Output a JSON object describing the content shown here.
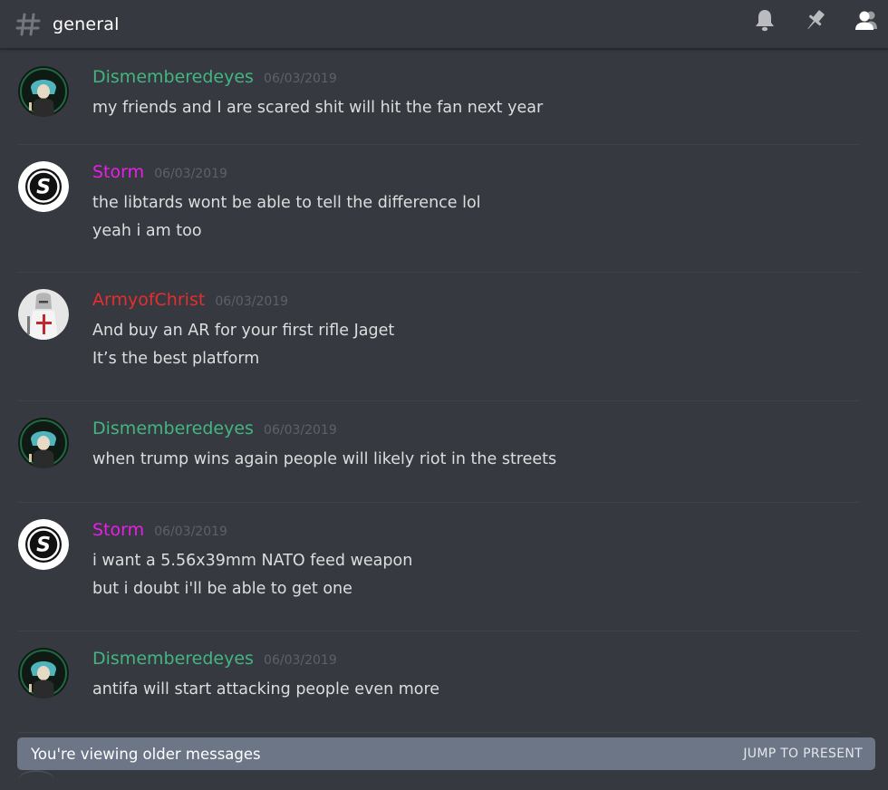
{
  "header": {
    "channel_name": "general",
    "icons": [
      "hash-icon",
      "bell-icon",
      "pin-icon",
      "members-icon"
    ]
  },
  "colors": {
    "background": "#36393f",
    "Dismemberedeyes": "#43b581",
    "Storm": "#e91ee9",
    "ArmyofChrist": "#e62e2e",
    "banner": "#6c7686"
  },
  "messages": [
    {
      "author": "Dismemberedeyes",
      "timestamp": "06/03/2019",
      "lines": [
        "my friends and I are scared shit will hit the fan next year"
      ]
    },
    {
      "author": "Storm",
      "timestamp": "06/03/2019",
      "lines": [
        "the libtards wont be able to tell the difference lol",
        "yeah i am too"
      ]
    },
    {
      "author": "ArmyofChrist",
      "timestamp": "06/03/2019",
      "lines": [
        "And buy an AR for your first rifle Jaget",
        "It’s the best platform"
      ]
    },
    {
      "author": "Dismemberedeyes",
      "timestamp": "06/03/2019",
      "lines": [
        "when trump wins again people will likely riot in the streets"
      ]
    },
    {
      "author": "Storm",
      "timestamp": "06/03/2019",
      "lines": [
        "i want a 5.56x39mm NATO feed weapon",
        "but i doubt i'll be able to get one"
      ]
    },
    {
      "author": "Dismemberedeyes",
      "timestamp": "06/03/2019",
      "lines": [
        "antifa will start attacking people even more"
      ]
    }
  ],
  "banner": {
    "text": "You're viewing older messages",
    "jump_label": "JUMP TO PRESENT"
  }
}
